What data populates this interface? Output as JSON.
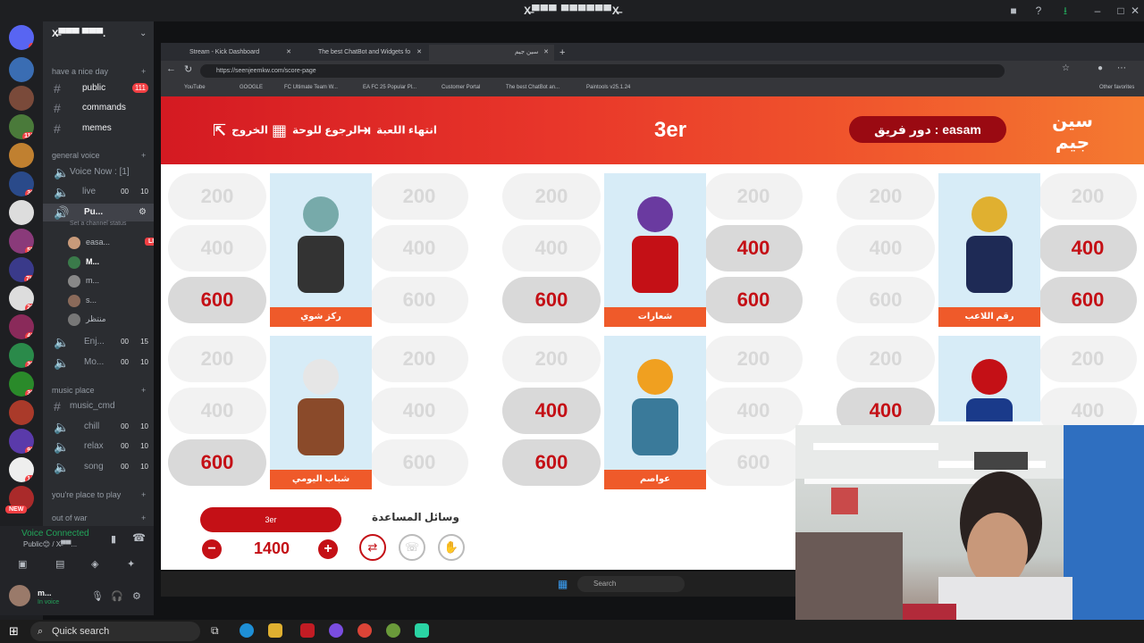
{
  "window_title": "X̶▀▀▀ ▀▀▀▀▀▀X̶",
  "discord": {
    "server_name": "X̶▀▀▀ ▀▀▀.",
    "greeting": "have a nice day",
    "text_channels": [
      {
        "name": "public",
        "badge": "111"
      },
      {
        "name": "commands"
      },
      {
        "name": "memes"
      }
    ],
    "categories": {
      "general_voice": "general voice",
      "music_place": "music place",
      "youre_place": "you're place to play",
      "out_of_war": "out of war"
    },
    "voice_now": "Voice Now : [1]",
    "voice_channels_top": [
      {
        "name": "live",
        "c1": "00",
        "c2": "10"
      },
      {
        "name": "Pu...",
        "status": "Set a channel status"
      },
      {
        "name": "Enj...",
        "c1": "00",
        "c2": "15"
      },
      {
        "name": "Mo...",
        "c1": "00",
        "c2": "10"
      }
    ],
    "users": [
      {
        "name": "easa...",
        "live": "LIVE"
      },
      {
        "name": "M..."
      },
      {
        "name": "m..."
      },
      {
        "name": "s..."
      },
      {
        "name": "منتظر"
      }
    ],
    "music_channels": [
      {
        "name": "music_cmd"
      },
      {
        "name": "chill",
        "c1": "00",
        "c2": "10"
      },
      {
        "name": "relax",
        "c1": "00",
        "c2": "10"
      },
      {
        "name": "song",
        "c1": "00",
        "c2": "10"
      }
    ],
    "voice_connected": "Voice Connected",
    "voice_sub": "Public😊 / X̶▀▀...",
    "me_name": "m...",
    "me_status": "In voice",
    "new_badge": "NEW"
  },
  "browser": {
    "tabs": [
      "Stream - Kick Dashboard",
      "The best ChatBot and Widgets fo",
      "سين جيم"
    ],
    "url": "https://seenjeemkw.com/score-page",
    "bookmarks": [
      "YouTube",
      "GOOGLE",
      "FC Ultimate Team W...",
      "EA FC 25 Popular Pl...",
      "Customer Portal",
      "The best ChatBot an...",
      "Paintools v25.1.24"
    ],
    "other_bookmarks": "Other favorites"
  },
  "game": {
    "exit_label": "الخروج",
    "back_label": "الرجوع للوحة",
    "end_label": "انتهاء اللعبة",
    "team_name": "3er",
    "turn_label": "دور فريق : easam",
    "brand": "سين جيم",
    "categories": [
      {
        "label": "ركز شوي",
        "left": [
          "200",
          "400",
          "600"
        ],
        "right": [
          "200",
          "400",
          "600"
        ],
        "lon": [
          false,
          false,
          true
        ],
        "ron": [
          false,
          false,
          false
        ]
      },
      {
        "label": "شعارات",
        "left": [
          "200",
          "400",
          "600"
        ],
        "right": [
          "200",
          "400",
          "600"
        ],
        "lon": [
          false,
          false,
          true
        ],
        "ron": [
          false,
          true,
          true
        ]
      },
      {
        "label": "رقم اللاعب",
        "left": [
          "200",
          "400",
          "600"
        ],
        "right": [
          "200",
          "400",
          "600"
        ],
        "lon": [
          false,
          false,
          false
        ],
        "ron": [
          false,
          true,
          true
        ]
      },
      {
        "label": "شباب اليومي",
        "left": [
          "200",
          "400",
          "600"
        ],
        "right": [
          "200",
          "400",
          "600"
        ],
        "lon": [
          false,
          false,
          true
        ],
        "ron": [
          false,
          false,
          false
        ]
      },
      {
        "label": "عواصم",
        "left": [
          "200",
          "400",
          "600"
        ],
        "right": [
          "200",
          "400",
          "600"
        ],
        "lon": [
          false,
          true,
          true
        ],
        "ron": [
          false,
          false,
          false
        ]
      },
      {
        "label": "",
        "left": [
          "200",
          "400"
        ],
        "right": [
          "200",
          "400"
        ],
        "lon": [
          false,
          true
        ],
        "ron": [
          false,
          false
        ]
      }
    ],
    "team_card_name": "3er",
    "score": "1400",
    "minus": "−",
    "plus": "+",
    "help_label": "وسائل المساعدة"
  },
  "taskbar": {
    "search": "Quick search",
    "inner_search": "Search"
  },
  "colors": {
    "accent": "#c41016",
    "header_start": "#d41a22",
    "header_end": "#f47a30",
    "label_orange": "#ef5a2a"
  }
}
